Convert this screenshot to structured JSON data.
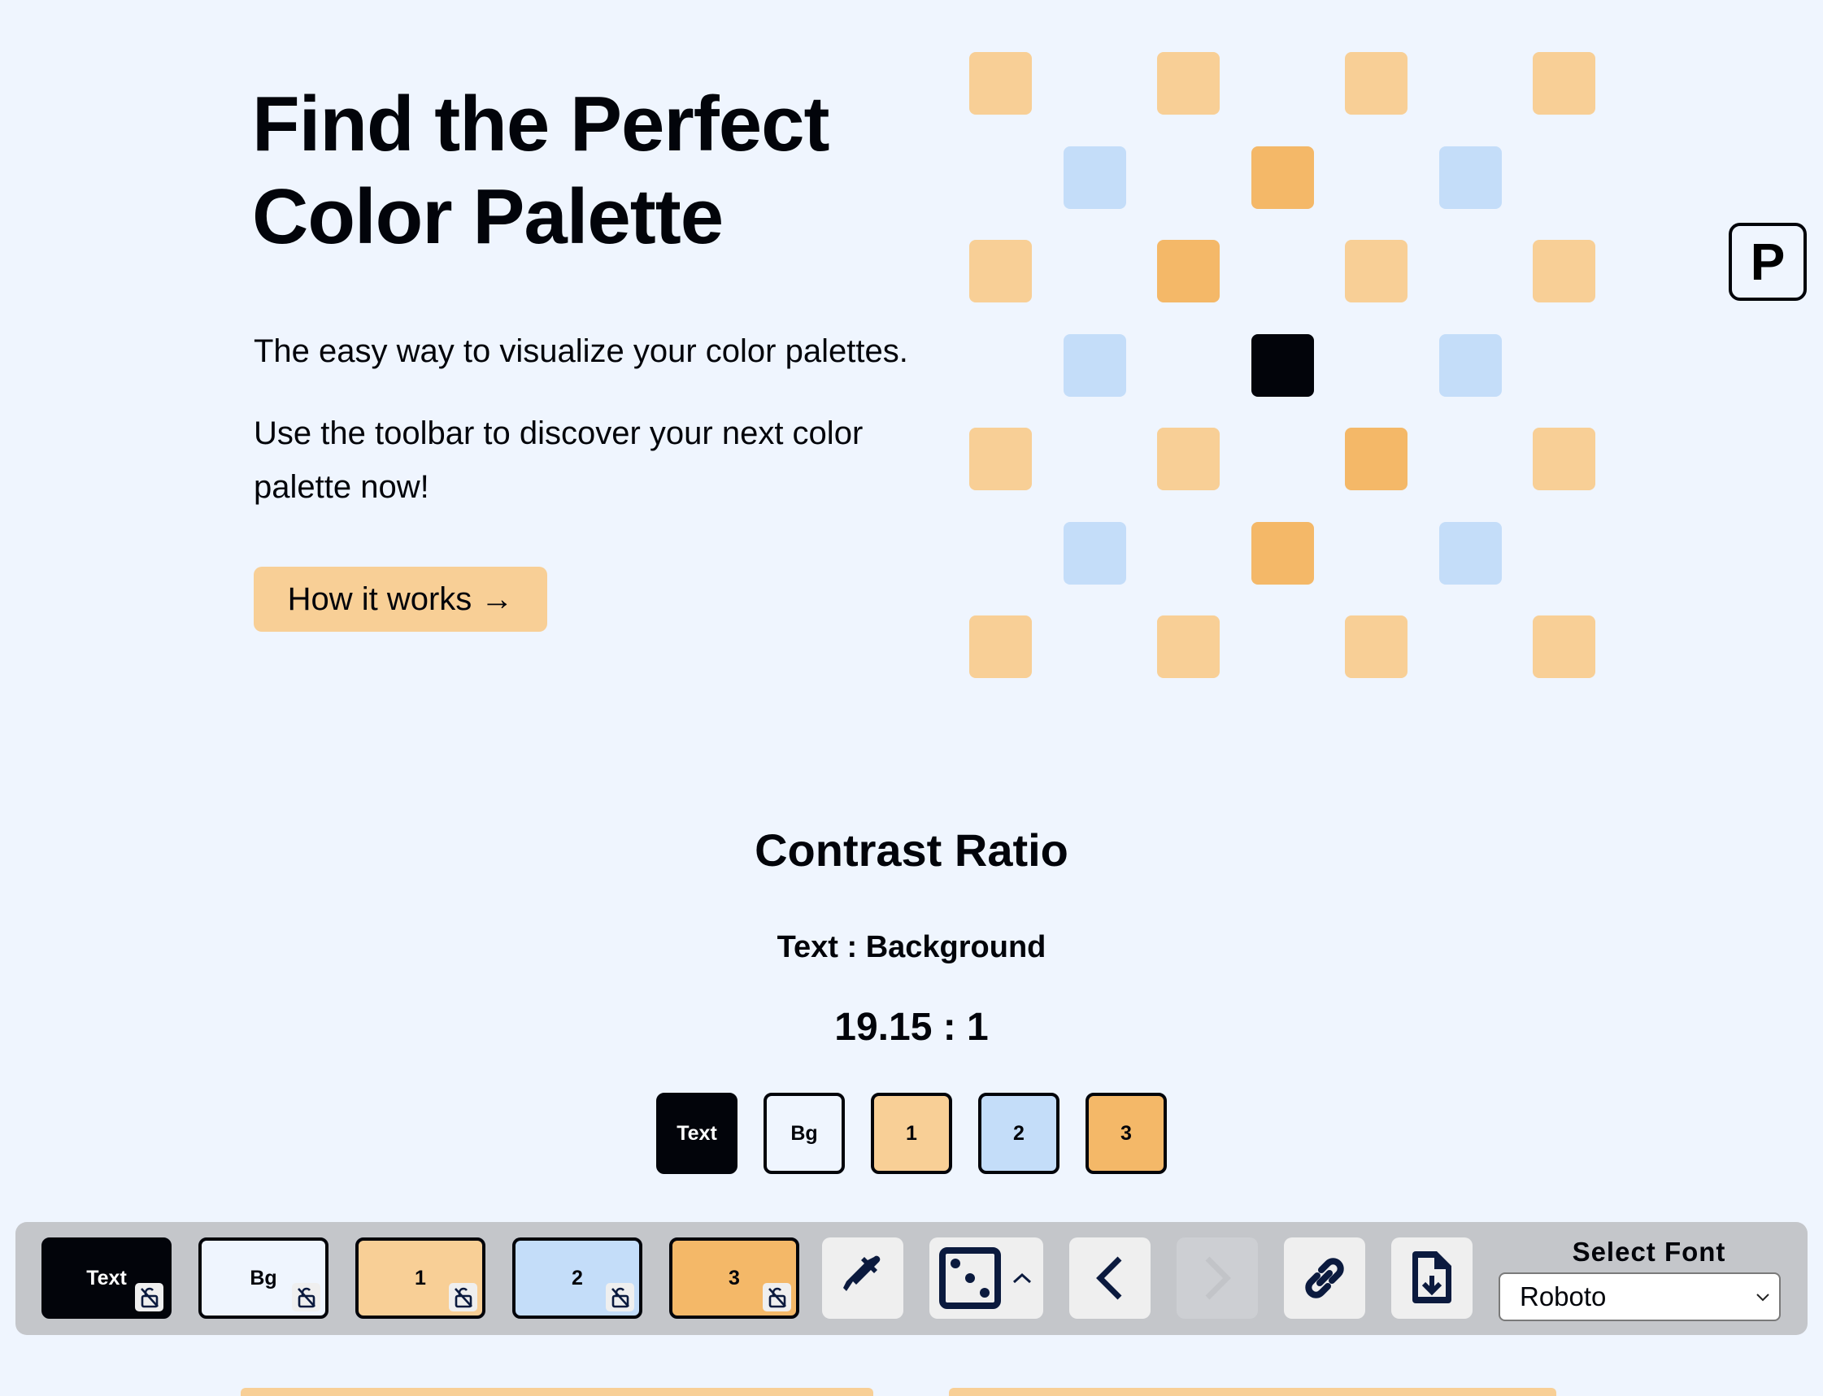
{
  "hero": {
    "title_line1": "Find the Perfect",
    "title_line2": "Color Palette",
    "subtitle1": "The easy way to visualize your color palettes.",
    "subtitle2": "Use the toolbar to discover your next color palette now!",
    "cta_label": "How it works →"
  },
  "palette": {
    "text": "#02040a",
    "bg": "#eff5fe",
    "c1": "#f8cf96",
    "c2": "#c4ddf9",
    "c3": "#f4b868"
  },
  "pattern_grid": [
    [
      "c1",
      null,
      "c1",
      null,
      "c1",
      null,
      "c1"
    ],
    [
      null,
      "c2",
      null,
      "c3",
      null,
      "c2",
      null
    ],
    [
      "c1",
      null,
      "c3",
      null,
      "c1",
      null,
      "c1"
    ],
    [
      null,
      "c2",
      null,
      "text",
      null,
      "c2",
      null
    ],
    [
      "c1",
      null,
      "c1",
      null,
      "c3",
      null,
      "c1"
    ],
    [
      null,
      "c2",
      null,
      "c3",
      null,
      "c2",
      null
    ],
    [
      "c1",
      null,
      "c1",
      null,
      "c1",
      null,
      "c1"
    ]
  ],
  "p_button_label": "P",
  "contrast": {
    "title": "Contrast Ratio",
    "pair_label": "Text : Background",
    "ratio": "19.15 : 1",
    "swatches": [
      {
        "label": "Text",
        "role": "text"
      },
      {
        "label": "Bg",
        "role": "bg"
      },
      {
        "label": "1",
        "role": "c1"
      },
      {
        "label": "2",
        "role": "c2"
      },
      {
        "label": "3",
        "role": "c3"
      }
    ]
  },
  "toolbar": {
    "swatches": [
      {
        "label": "Text",
        "role": "text",
        "lock_icon": "lock-open-slash-icon"
      },
      {
        "label": "Bg",
        "role": "bg",
        "lock_icon": "lock-open-slash-icon"
      },
      {
        "label": "1",
        "role": "c1",
        "lock_icon": "lock-open-slash-icon"
      },
      {
        "label": "2",
        "role": "c2",
        "lock_icon": "lock-open-slash-icon"
      },
      {
        "label": "3",
        "role": "c3",
        "lock_icon": "lock-open-slash-icon"
      }
    ],
    "buttons": [
      {
        "name": "eyedropper",
        "icon": "eyedropper-icon",
        "disabled": false
      },
      {
        "name": "randomize",
        "icon": "dice-icon",
        "disabled": false
      },
      {
        "name": "previous",
        "icon": "chevron-left-icon",
        "disabled": false
      },
      {
        "name": "next",
        "icon": "chevron-right-icon",
        "disabled": true
      },
      {
        "name": "share-link",
        "icon": "link-icon",
        "disabled": false
      },
      {
        "name": "export",
        "icon": "file-download-icon",
        "disabled": false
      }
    ],
    "font_label": "Select Font",
    "font_value": "Roboto"
  }
}
